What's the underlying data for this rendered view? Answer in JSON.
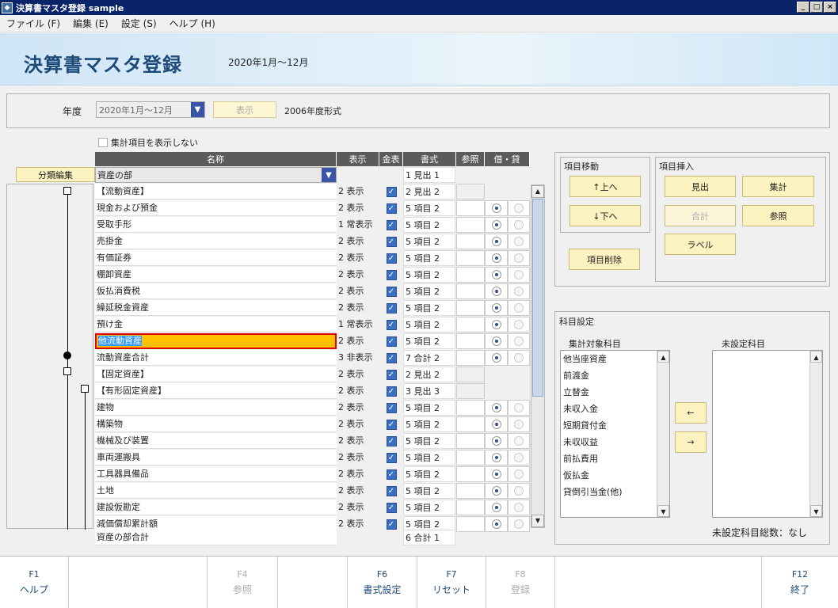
{
  "window": {
    "title": "決算書マスタ登録 sample",
    "btn_min": "_",
    "btn_max": "□",
    "btn_close": "×"
  },
  "menu": [
    {
      "label": "ファイル (F)"
    },
    {
      "label": "編集 (E)"
    },
    {
      "label": "設定 (S)"
    },
    {
      "label": "ヘルプ (H)"
    }
  ],
  "header": {
    "title": "決算書マスタ登録",
    "period": "2020年1月～12月"
  },
  "year": {
    "label": "年度",
    "value": "2020年1月～12月",
    "show_btn": "表示",
    "format": "2006年度形式"
  },
  "hide_sum_label": "集計項目を表示しない",
  "class_edit_btn": "分類編集",
  "grid": {
    "headers": {
      "name": "名称",
      "disp": "表示",
      "kin": "金表",
      "fmt": "書式",
      "ref": "参照",
      "drcr": "借・貸"
    },
    "top_row": {
      "name": "資産の部",
      "fmt": "1 見出 1"
    },
    "rows": [
      {
        "name": "【流動資産】",
        "disp": "2 表示",
        "kin": true,
        "fmt": "2 見出 2",
        "type": "group"
      },
      {
        "name": "現金および預金",
        "disp": "2 表示",
        "kin": true,
        "fmt": "5 項目 2",
        "type": "item"
      },
      {
        "name": "受取手形",
        "disp": "1 常表示",
        "kin": true,
        "fmt": "5 項目 2",
        "type": "item"
      },
      {
        "name": "売掛金",
        "disp": "2 表示",
        "kin": true,
        "fmt": "5 項目 2",
        "type": "item"
      },
      {
        "name": "有価証券",
        "disp": "2 表示",
        "kin": true,
        "fmt": "5 項目 2",
        "type": "item"
      },
      {
        "name": "棚卸資産",
        "disp": "2 表示",
        "kin": true,
        "fmt": "5 項目 2",
        "type": "item"
      },
      {
        "name": "仮払消費税",
        "disp": "2 表示",
        "kin": true,
        "fmt": "5 項目 2",
        "type": "item"
      },
      {
        "name": "繰延税金資産",
        "disp": "2 表示",
        "kin": true,
        "fmt": "5 項目 2",
        "type": "item"
      },
      {
        "name": "預け金",
        "disp": "1 常表示",
        "kin": true,
        "fmt": "5 項目 2",
        "type": "item"
      },
      {
        "name": "他流動資産",
        "disp": "2 表示",
        "kin": true,
        "fmt": "5 項目 2",
        "type": "selected"
      },
      {
        "name": "流動資産合計",
        "disp": "3 非表示",
        "kin": true,
        "fmt": "7 合計 2",
        "type": "item"
      },
      {
        "name": "【固定資産】",
        "disp": "2 表示",
        "kin": true,
        "fmt": "2 見出 2",
        "type": "group"
      },
      {
        "name": "【有形固定資産】",
        "disp": "2 表示",
        "kin": true,
        "fmt": "3 見出 3",
        "type": "group"
      },
      {
        "name": "建物",
        "disp": "2 表示",
        "kin": true,
        "fmt": "5 項目 2",
        "type": "item"
      },
      {
        "name": "構築物",
        "disp": "2 表示",
        "kin": true,
        "fmt": "5 項目 2",
        "type": "item"
      },
      {
        "name": "機械及び装置",
        "disp": "2 表示",
        "kin": true,
        "fmt": "5 項目 2",
        "type": "item"
      },
      {
        "name": "車両運搬具",
        "disp": "2 表示",
        "kin": true,
        "fmt": "5 項目 2",
        "type": "item"
      },
      {
        "name": "工具器具備品",
        "disp": "2 表示",
        "kin": true,
        "fmt": "5 項目 2",
        "type": "item"
      },
      {
        "name": "土地",
        "disp": "2 表示",
        "kin": true,
        "fmt": "5 項目 2",
        "type": "item"
      },
      {
        "name": "建設仮勘定",
        "disp": "2 表示",
        "kin": true,
        "fmt": "5 項目 2",
        "type": "item"
      },
      {
        "name": "減価償却累計額",
        "disp": "2 表示",
        "kin": true,
        "fmt": "5 項目 2",
        "type": "item"
      }
    ],
    "bottom_row": {
      "name": "資産の部合計",
      "fmt": "6 合計 1"
    }
  },
  "move": {
    "title": "項目移動",
    "up": "↑上へ",
    "down": "↓下へ",
    "delete": "項目削除"
  },
  "insert": {
    "title": "項目挿入",
    "heading": "見出",
    "sum": "集計",
    "total": "合計",
    "ref": "参照",
    "label": "ラベル"
  },
  "account": {
    "title": "科目設定",
    "target_title": "集計対象科目",
    "unset_title": "未設定科目",
    "targets": [
      "他当座資産",
      "前渡金",
      "立替金",
      "未収入金",
      "短期貸付金",
      "未収収益",
      "前払費用",
      "仮払金",
      "貸倒引当金(他)"
    ],
    "left_arrow": "←",
    "right_arrow": "→",
    "unset_count": "未設定科目総数：なし"
  },
  "fkeys": [
    {
      "key": "F1",
      "label": "ヘルプ",
      "enabled": true
    },
    {
      "key": "F4",
      "label": "参照",
      "enabled": false
    },
    {
      "key": "F6",
      "label": "書式設定",
      "enabled": true
    },
    {
      "key": "F7",
      "label": "リセット",
      "enabled": true
    },
    {
      "key": "F8",
      "label": "登録",
      "enabled": false
    },
    {
      "key": "F12",
      "label": "終了",
      "enabled": true
    }
  ]
}
